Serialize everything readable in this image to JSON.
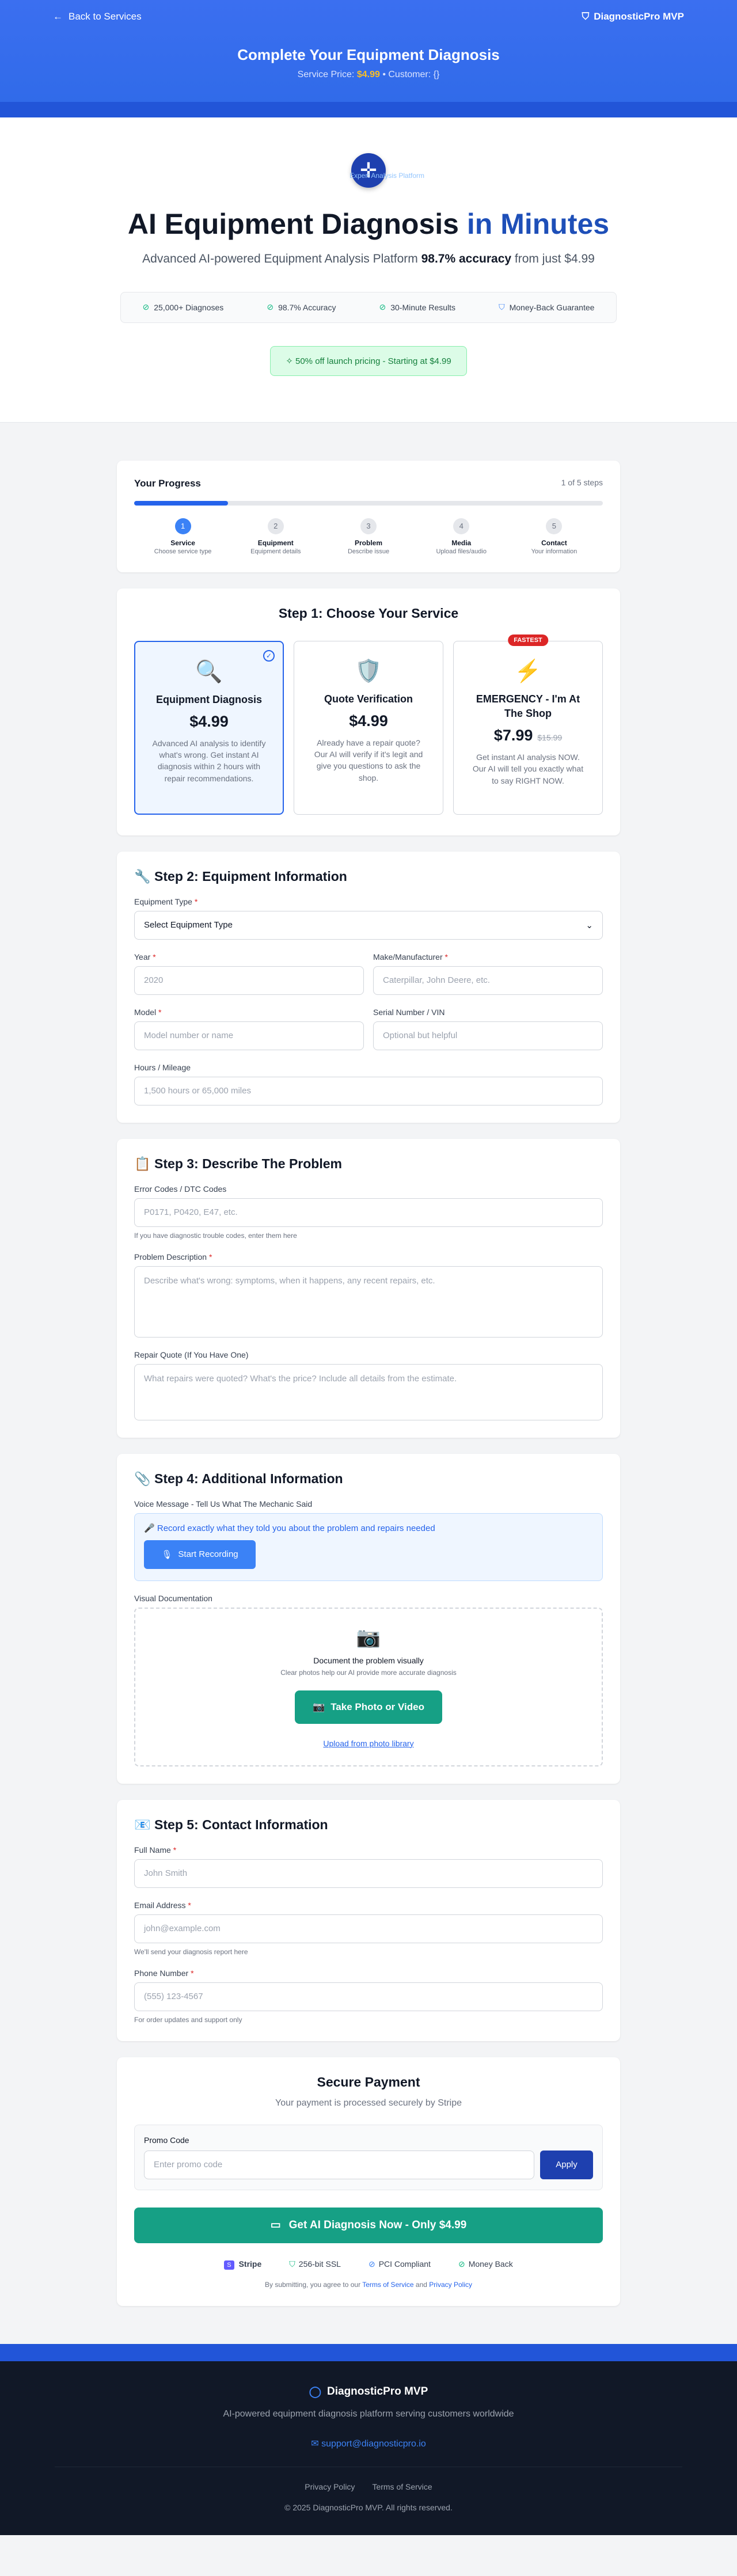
{
  "header": {
    "back_label": "Back to Services",
    "brand": "DiagnosticPro MVP",
    "title": "Complete Your Equipment Diagnosis",
    "price_label": "Service Price:",
    "price_value": "$4.99",
    "customer_label": "• Customer: {}"
  },
  "hero": {
    "logo_tag": "Expert Analysis Platform",
    "title_main": "AI Equipment Diagnosis",
    "title_accent": "in Minutes",
    "subtitle_pre": "Advanced AI-powered Equipment Analysis Platform",
    "subtitle_bold": "98.7% accuracy",
    "subtitle_post": "from just $4.99",
    "badges": [
      "25,000+ Diagnoses",
      "98.7% Accuracy",
      "30-Minute Results",
      "Money-Back Guarantee"
    ],
    "launch": "50% off launch pricing - Starting at $4.99"
  },
  "progress": {
    "title": "Your Progress",
    "count": "1 of 5 steps",
    "value": 0.2,
    "steps": [
      {
        "n": "1",
        "label": "Service",
        "desc": "Choose service type"
      },
      {
        "n": "2",
        "label": "Equipment",
        "desc": "Equipment details"
      },
      {
        "n": "3",
        "label": "Problem",
        "desc": "Describe issue"
      },
      {
        "n": "4",
        "label": "Media",
        "desc": "Upload files/audio"
      },
      {
        "n": "5",
        "label": "Contact",
        "desc": "Your information"
      }
    ]
  },
  "step1": {
    "title": "Step 1: Choose Your Service",
    "services": [
      {
        "name": "Equipment Diagnosis",
        "price": "$4.99",
        "desc": "Advanced AI analysis to identify what's wrong. Get instant AI diagnosis within 2 hours with repair recommendations."
      },
      {
        "name": "Quote Verification",
        "price": "$4.99",
        "desc": "Already have a repair quote? Our AI will verify if it's legit and give you questions to ask the shop."
      },
      {
        "name": "EMERGENCY - I'm At The Shop",
        "price": "$7.99",
        "old_price": "$15.99",
        "tag": "FASTEST",
        "desc": "Get instant AI analysis NOW. Our AI will tell you exactly what to say RIGHT NOW."
      }
    ]
  },
  "step2": {
    "title": "Step 2: Equipment Information",
    "type_label": "Equipment Type",
    "type_value": "Select Equipment Type",
    "year_label": "Year",
    "year_ph": "2020",
    "make_label": "Make/Manufacturer",
    "make_ph": "Caterpillar, John Deere, etc.",
    "model_label": "Model",
    "model_ph": "Model number or name",
    "serial_label": "Serial Number / VIN",
    "serial_ph": "Optional but helpful",
    "hours_label": "Hours / Mileage",
    "hours_ph": "1,500 hours or 65,000 miles"
  },
  "step3": {
    "title": "Step 3: Describe The Problem",
    "codes_label": "Error Codes / DTC Codes",
    "codes_ph": "P0171, P0420, E47, etc.",
    "codes_hint": "If you have diagnostic trouble codes, enter them here",
    "desc_label": "Problem Description",
    "desc_ph": "Describe what's wrong: symptoms, when it happens, any recent repairs, etc.",
    "quote_label": "Repair Quote (If You Have One)",
    "quote_ph": "What repairs were quoted? What's the price? Include all details from the estimate."
  },
  "step4": {
    "title": "Step 4: Additional Information",
    "voice_label": "Voice Message - Tell Us What The Mechanic Said",
    "voice_prompt": "Record exactly what they told you about the problem and repairs needed",
    "record_btn": "Start Recording",
    "visual_label": "Visual Documentation",
    "drop_title": "Document the problem visually",
    "drop_sub": "Clear photos help our AI provide more accurate diagnosis",
    "take_btn": "Take Photo or Video",
    "upload_link": "Upload from photo library"
  },
  "step5": {
    "title": "Step 5: Contact Information",
    "name_label": "Full Name",
    "name_ph": "John Smith",
    "email_label": "Email Address",
    "email_ph": "john@example.com",
    "email_hint": "We'll send your diagnosis report here",
    "phone_label": "Phone Number",
    "phone_ph": "(555) 123-4567",
    "phone_hint": "For order updates and support only"
  },
  "payment": {
    "title": "Secure Payment",
    "sub": "Your payment is processed securely by Stripe",
    "promo_label": "Promo Code",
    "promo_ph": "Enter promo code",
    "apply": "Apply",
    "cta": "Get AI Diagnosis Now - Only $4.99",
    "trust": [
      "Stripe",
      "256-bit SSL",
      "PCI Compliant",
      "Money Back"
    ],
    "legal_pre": "By submitting, you agree to our",
    "terms": "Terms of Service",
    "and": "and",
    "privacy": "Privacy Policy"
  },
  "footer": {
    "brand": "DiagnosticPro MVP",
    "desc": "AI-powered equipment diagnosis platform serving customers worldwide",
    "email": "support@diagnosticpro.io",
    "links": [
      "Privacy Policy",
      "Terms of Service"
    ],
    "copyright": "© 2025 DiagnosticPro MVP. All rights reserved."
  },
  "colors": {
    "primary": "#2563eb",
    "brand_dark": "#1e40af",
    "cta_green": "#16a085",
    "header_blue": "#3b6ff0",
    "footer_bg": "#111827",
    "danger": "#dc2626"
  }
}
